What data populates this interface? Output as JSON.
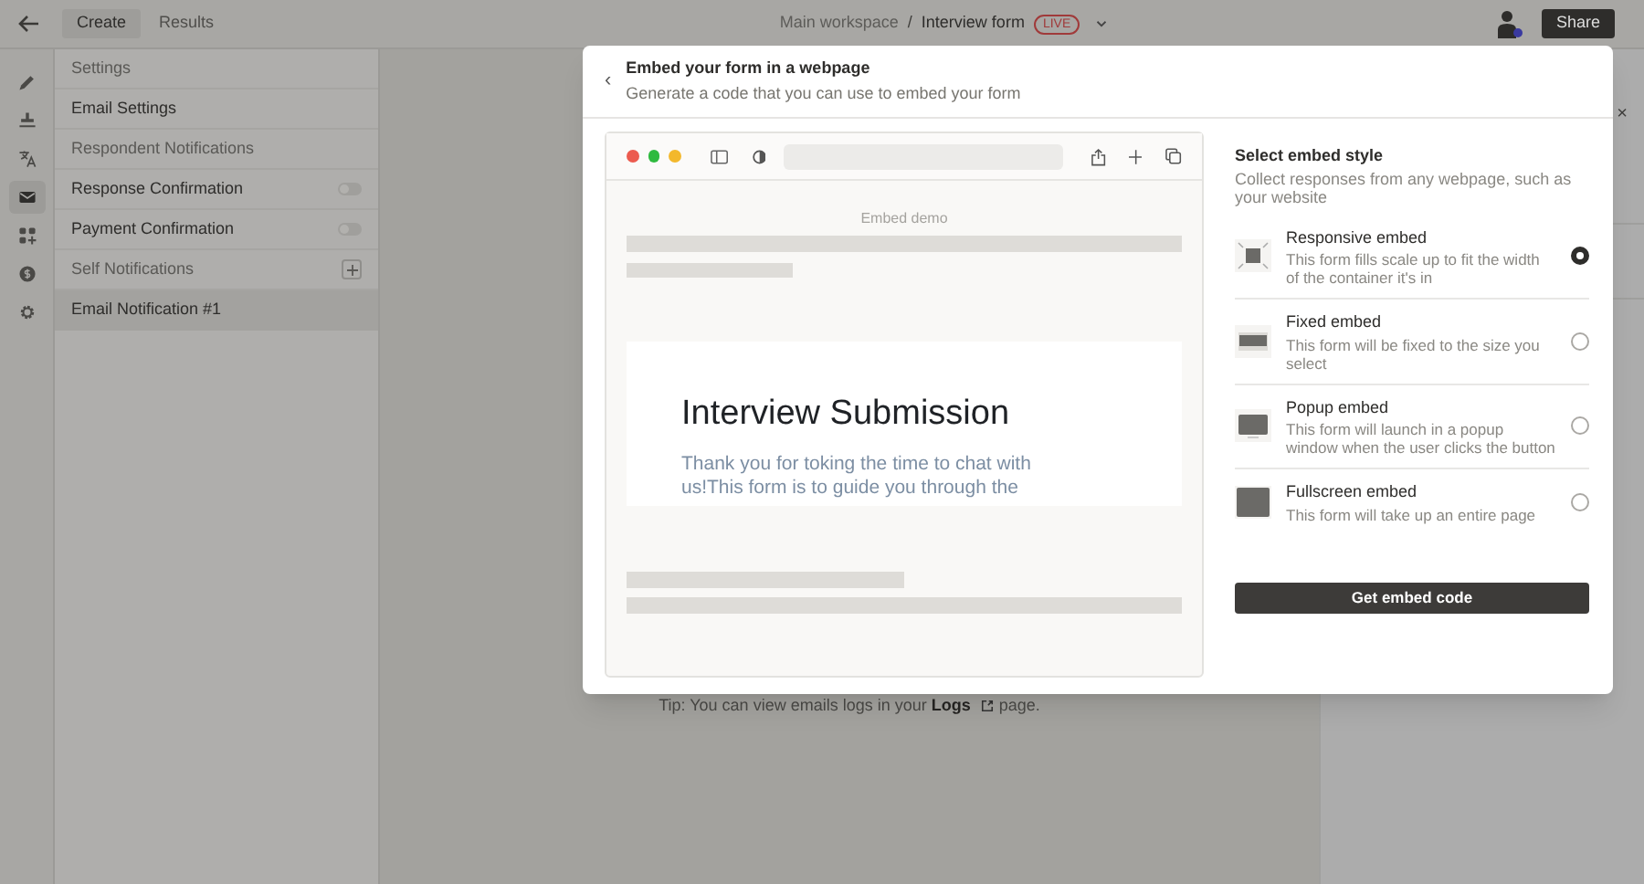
{
  "topbar": {
    "tabs": [
      {
        "label": "Create",
        "selected": true
      },
      {
        "label": "Results",
        "selected": false
      }
    ],
    "breadcrumb": [
      "Main workspace",
      "Interview form"
    ],
    "separator": "/",
    "status_badge": "LIVE",
    "share_button": "Share"
  },
  "rail": [
    {
      "kind": "pencil",
      "selected": false
    },
    {
      "kind": "stamp",
      "selected": false
    },
    {
      "kind": "translate",
      "selected": false
    },
    {
      "kind": "mail",
      "selected": true
    },
    {
      "kind": "blocks",
      "selected": false
    },
    {
      "kind": "coin",
      "selected": false
    },
    {
      "kind": "gear",
      "selected": false
    }
  ],
  "settings_panel": [
    {
      "kind": "header",
      "label": "Settings"
    },
    {
      "kind": "item",
      "label": "Email Settings",
      "selected": false
    },
    {
      "kind": "header",
      "label": "Respondent Notifications"
    },
    {
      "kind": "toggle",
      "label": "Response Confirmation",
      "on": false
    },
    {
      "kind": "toggle",
      "label": "Payment Confirmation",
      "on": false
    },
    {
      "kind": "add_header",
      "label": "Self Notifications"
    },
    {
      "kind": "item",
      "label": "Email Notification #1",
      "selected": true
    }
  ],
  "tip": {
    "text": "Tip: You can view emails logs in your",
    "link": "Logs",
    "end": "page."
  },
  "right_panel": {
    "close": "×"
  },
  "modal": {
    "back": "‹",
    "title": "Embed your form in a webpage",
    "subtitle": "Generate a code that you can use to embed your form",
    "preview": {
      "label": "Embed demo",
      "form_title": "Interview Submission",
      "form_text": "Thank you for toking the time to chat with us!This form is to guide you through the"
    },
    "style_picker": {
      "title": "Select embed style",
      "description": "Collect responses from any webpage, such as your website",
      "options": [
        {
          "kind": "responsive",
          "title": "Responsive embed",
          "description": "This form fills scale up to fit the width of the container it's in",
          "selected": true
        },
        {
          "kind": "fixed",
          "title": "Fixed embed",
          "description": "This form will be fixed to the size you select",
          "selected": false
        },
        {
          "kind": "popup",
          "title": "Popup embed",
          "description": "This form will launch in a popup window when the user clicks the button",
          "selected": false
        },
        {
          "kind": "fullscreen",
          "title": "Fullscreen embed",
          "description": "This form will take up an entire page",
          "selected": false
        }
      ]
    },
    "button": "Get embed code"
  }
}
